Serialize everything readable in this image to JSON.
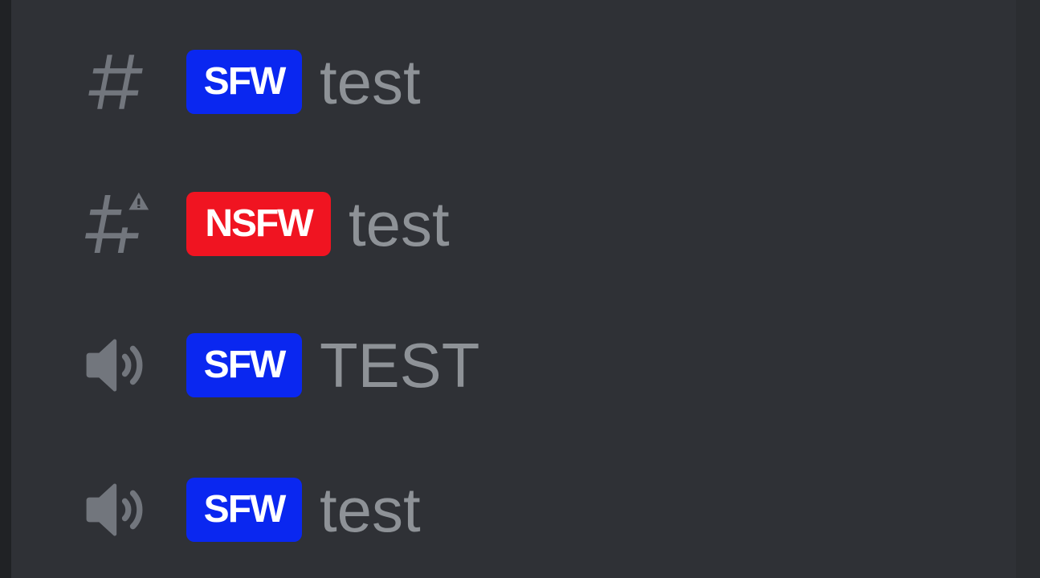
{
  "channels": [
    {
      "type": "text",
      "icon": "hashtag-icon",
      "tag": "SFW",
      "tag_color": "#0a27f0",
      "name": "test"
    },
    {
      "type": "text-nsfw",
      "icon": "hashtag-warning-icon",
      "tag": "NSFW",
      "tag_color": "#f01421",
      "name": "test"
    },
    {
      "type": "voice",
      "icon": "speaker-icon",
      "tag": "SFW",
      "tag_color": "#0a27f0",
      "name": "TEST"
    },
    {
      "type": "voice",
      "icon": "speaker-icon",
      "tag": "SFW",
      "tag_color": "#0a27f0",
      "name": "test"
    }
  ],
  "colors": {
    "background": "#2f3136",
    "channel_text": "#8e9297",
    "icon": "#72767d"
  }
}
